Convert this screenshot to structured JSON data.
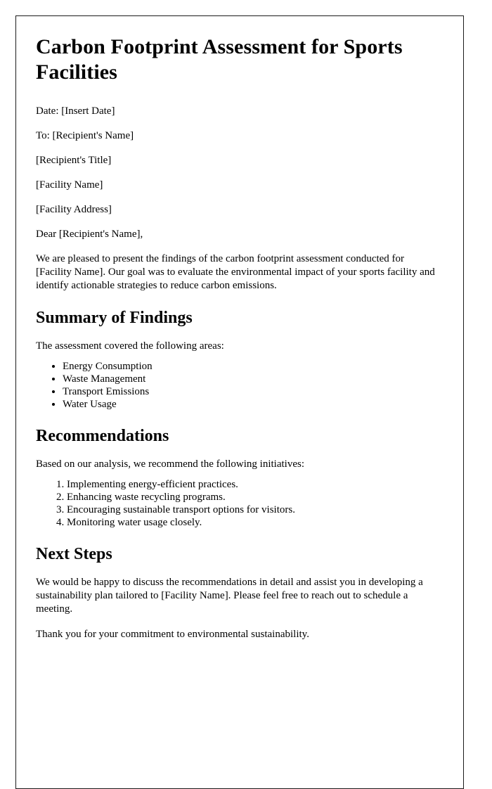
{
  "document": {
    "title": "Carbon Footprint Assessment for Sports Facilities",
    "meta": {
      "date_line": "Date: [Insert Date]",
      "to_line": "To: [Recipient's Name]",
      "recipient_title": "[Recipient's Title]",
      "facility_name": "[Facility Name]",
      "facility_address": "[Facility Address]",
      "salutation": "Dear [Recipient's Name],"
    },
    "intro_paragraph": "We are pleased to present the findings of the carbon footprint assessment conducted for [Facility Name]. Our goal was to evaluate the environmental impact of your sports facility and identify actionable strategies to reduce carbon emissions.",
    "sections": [
      {
        "heading": "Summary of Findings",
        "lead_in": "The assessment covered the following areas:",
        "list_type": "bullet",
        "items": [
          "Energy Consumption",
          "Waste Management",
          "Transport Emissions",
          "Water Usage"
        ]
      },
      {
        "heading": "Recommendations",
        "lead_in": "Based on our analysis, we recommend the following initiatives:",
        "list_type": "number",
        "items": [
          "Implementing energy-efficient practices.",
          "Enhancing waste recycling programs.",
          "Encouraging sustainable transport options for visitors.",
          "Monitoring water usage closely."
        ]
      },
      {
        "heading": "Next Steps",
        "lead_in": "",
        "list_type": "none",
        "items": []
      }
    ],
    "next_steps_paragraph": "We would be happy to discuss the recommendations in detail and assist you in developing a sustainability plan tailored to [Facility Name]. Please feel free to reach out to schedule a meeting.",
    "closing_paragraph": "Thank you for your commitment to environmental sustainability."
  },
  "colors": {
    "text": "#000000",
    "page_background": "#ffffff",
    "page_border": "#1b1b1b"
  }
}
